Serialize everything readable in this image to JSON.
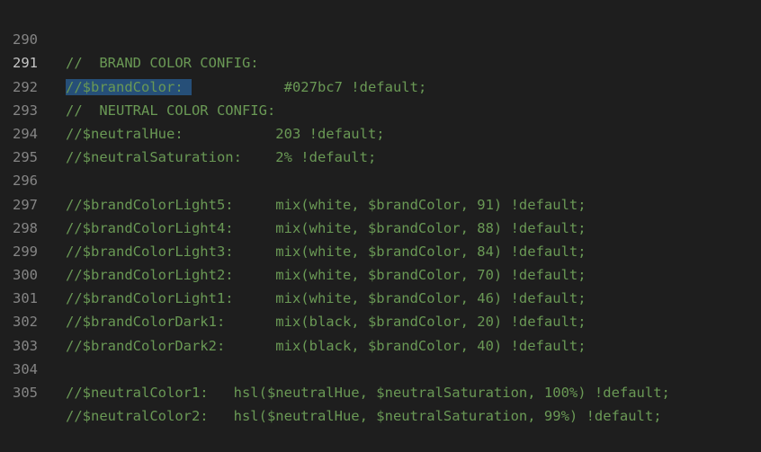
{
  "editor": {
    "lines": [
      {
        "number": "290",
        "text": "//  BRAND COLOR CONFIG:"
      },
      {
        "number": "291",
        "selected": "//$brandColor: ",
        "rest": "           #027bc7 !default;"
      },
      {
        "number": "292",
        "text": "//  NEUTRAL COLOR CONFIG:"
      },
      {
        "number": "293",
        "text": "//$neutralHue:           203 !default;"
      },
      {
        "number": "294",
        "text": "//$neutralSaturation:    2% !default;"
      },
      {
        "number": "295",
        "text": ""
      },
      {
        "number": "296",
        "text": "//$brandColorLight5:     mix(white, $brandColor, 91) !default;"
      },
      {
        "number": "297",
        "text": "//$brandColorLight4:     mix(white, $brandColor, 88) !default;"
      },
      {
        "number": "298",
        "text": "//$brandColorLight3:     mix(white, $brandColor, 84) !default;"
      },
      {
        "number": "299",
        "text": "//$brandColorLight2:     mix(white, $brandColor, 70) !default;"
      },
      {
        "number": "300",
        "text": "//$brandColorLight1:     mix(white, $brandColor, 46) !default;"
      },
      {
        "number": "301",
        "text": "//$brandColorDark1:      mix(black, $brandColor, 20) !default;"
      },
      {
        "number": "302",
        "text": "//$brandColorDark2:      mix(black, $brandColor, 40) !default;"
      },
      {
        "number": "303",
        "text": ""
      },
      {
        "number": "304",
        "text": "//$neutralColor1:   hsl($neutralHue, $neutralSaturation, 100%) !default;"
      },
      {
        "number": "305",
        "text": "//$neutralColor2:   hsl($neutralHue, $neutralSaturation, 99%) !default;"
      }
    ]
  },
  "colors": {
    "background": "#1e1e1e",
    "comment": "#6a9955",
    "line_number": "#858585",
    "active_line_number": "#c6c6c6",
    "selection": "#264f78"
  }
}
